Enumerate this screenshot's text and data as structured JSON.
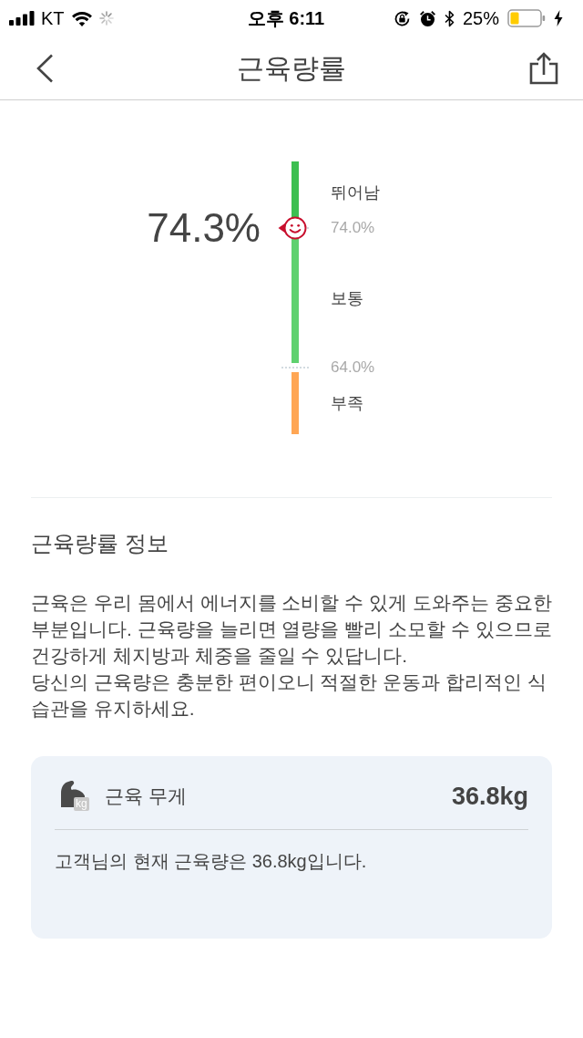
{
  "status_bar": {
    "carrier": "KT",
    "time": "오후 6:11",
    "battery": "25%"
  },
  "nav": {
    "title": "근육량률"
  },
  "gauge": {
    "value": "74.3%",
    "level": 0.756,
    "scale": [
      {
        "kind": "band",
        "label": "뛰어남",
        "color": "#3cbf51"
      },
      {
        "kind": "threshold",
        "label": "74.0%"
      },
      {
        "kind": "band",
        "label": "보통",
        "color": "#5fd16f"
      },
      {
        "kind": "threshold",
        "label": "64.0%"
      },
      {
        "kind": "band",
        "label": "부족",
        "color": "#ffa654"
      }
    ]
  },
  "info": {
    "heading": "근육량률 정보",
    "paragraphs": [
      "근육은 우리 몸에서 에너지를 소비할 수 있게 도와주는 중요한 부분입니다. 근육량을 늘리면 열량을 빨리 소모할 수 있으므로 건강하게 체지방과 체중을 줄일 수 있답니다.",
      "당신의 근육량은 충분한 편이오니 적절한 운동과 합리적인 식습관을 유지하세요."
    ]
  },
  "muscle_card": {
    "icon_badge": "kg",
    "label": "근육 무게",
    "value": "36.8kg",
    "note": "고객님의 현재 근육량은 36.8kg입니다."
  }
}
